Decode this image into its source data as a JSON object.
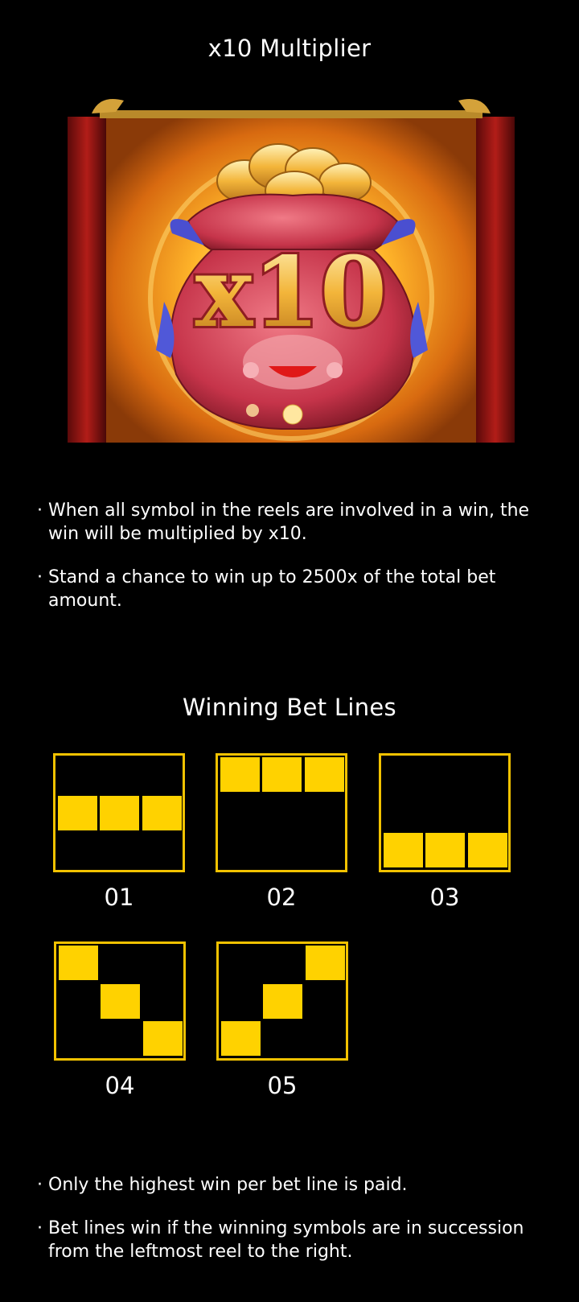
{
  "multiplier_section": {
    "title": "x10 Multiplier",
    "artwork_text": "x10",
    "bullets": [
      "When all symbol in the reels are involved in a win, the win will be multiplied by x10.",
      "Stand a chance to win up to 2500x of the total bet amount."
    ]
  },
  "bet_lines_section": {
    "title": "Winning Bet Lines",
    "lines": [
      {
        "label": "01",
        "pattern": [
          "middle",
          "middle",
          "middle"
        ]
      },
      {
        "label": "02",
        "pattern": [
          "top",
          "top",
          "top"
        ]
      },
      {
        "label": "03",
        "pattern": [
          "bottom",
          "bottom",
          "bottom"
        ]
      },
      {
        "label": "04",
        "pattern": [
          "top",
          "middle",
          "bottom"
        ]
      },
      {
        "label": "05",
        "pattern": [
          "bottom",
          "middle",
          "top"
        ]
      }
    ],
    "bullets": [
      "Only the highest win per bet line is paid.",
      "Bet lines win if the winning symbols are in succession from the leftmost reel to the right."
    ]
  },
  "colors": {
    "background": "#000000",
    "line_highlight": "#ffd200",
    "line_border": "#f2c200"
  },
  "bullet_char": "·"
}
